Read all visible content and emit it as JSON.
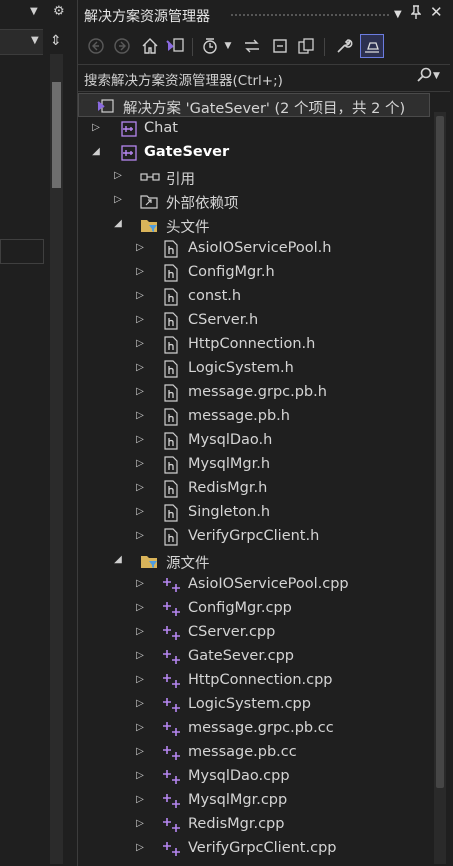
{
  "solution_explorer": {
    "title": "解决方案资源管理器",
    "search_placeholder": "搜索解决方案资源管理器(Ctrl+;)",
    "solution_label": "解决方案 'GateSever' (2 个项目，共 2 个)"
  },
  "left_strip": {
    "dropdown_icon": "chevron-down-icon",
    "gear_icon": "gear-icon",
    "split_icon": "split-icon"
  },
  "toolbar": {
    "buttons": [
      "back-icon",
      "forward-icon",
      "home-icon",
      "switch-views-icon",
      "history-icon",
      "sync-icon",
      "collapse-all-icon",
      "show-all-files-icon",
      "properties-icon",
      "preview-icon"
    ]
  },
  "tree": {
    "project_chat": "Chat",
    "project_gatesever": "GateSever",
    "references": "引用",
    "external_deps": "外部依赖项",
    "headers_folder": "头文件",
    "headers": [
      "AsioIOServicePool.h",
      "ConfigMgr.h",
      "const.h",
      "CServer.h",
      "HttpConnection.h",
      "LogicSystem.h",
      "message.grpc.pb.h",
      "message.pb.h",
      "MysqlDao.h",
      "MysqlMgr.h",
      "RedisMgr.h",
      "Singleton.h",
      "VerifyGrpcClient.h"
    ],
    "sources_folder": "源文件",
    "sources": [
      "AsioIOServicePool.cpp",
      "ConfigMgr.cpp",
      "CServer.cpp",
      "GateSever.cpp",
      "HttpConnection.cpp",
      "LogicSystem.cpp",
      "message.grpc.pb.cc",
      "message.pb.cc",
      "MysqlDao.cpp",
      "MysqlMgr.cpp",
      "RedisMgr.cpp",
      "VerifyGrpcClient.cpp"
    ]
  },
  "colors": {
    "accent": "#6b7ce0",
    "background": "#1f1f1f",
    "project_purple": "#a070e0",
    "folder_yellow": "#d9b45a",
    "cpp_purple": "#b586f0"
  }
}
